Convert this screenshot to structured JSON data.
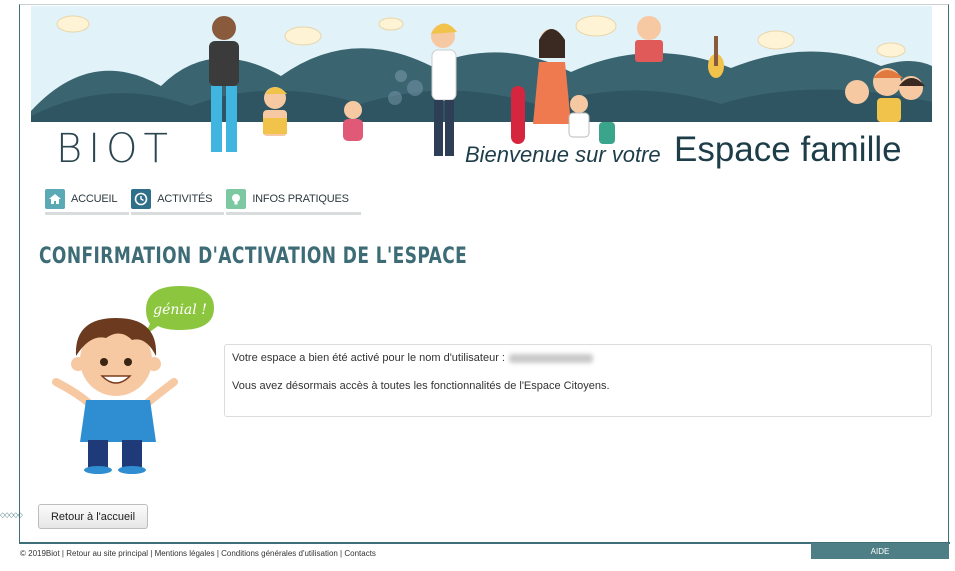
{
  "banner": {
    "logo": "BIOT",
    "welcome": "Bienvenue sur votre",
    "espace": "Espace famille"
  },
  "nav": [
    {
      "label": "ACCUEIL",
      "icon": "home-icon",
      "color": "#5aa9b5"
    },
    {
      "label": "ACTIVITÉS",
      "icon": "clock-icon",
      "color": "#2f6f8a"
    },
    {
      "label": "INFOS PRATIQUES",
      "icon": "lightbulb-icon",
      "color": "#7cc8a0"
    }
  ],
  "page_title": "CONFIRMATION D'ACTIVATION DE L'ESPACE",
  "bubble_text": "génial !",
  "message": {
    "line1": "Votre espace a bien été activé pour le nom d'utilisateur :",
    "line2": "Vous avez désormais accès à toutes les fonctionnalités de l'Espace Citoyens."
  },
  "back_button": "Retour à l'accueil",
  "footer": "© 2019Biot | Retour au site principal | Mentions légales | Conditions générales d'utilisation | Contacts",
  "aide": "AIDE",
  "colors": {
    "accent": "#3f6f78",
    "title": "#3d6b76",
    "bubble": "#8cc63f"
  }
}
